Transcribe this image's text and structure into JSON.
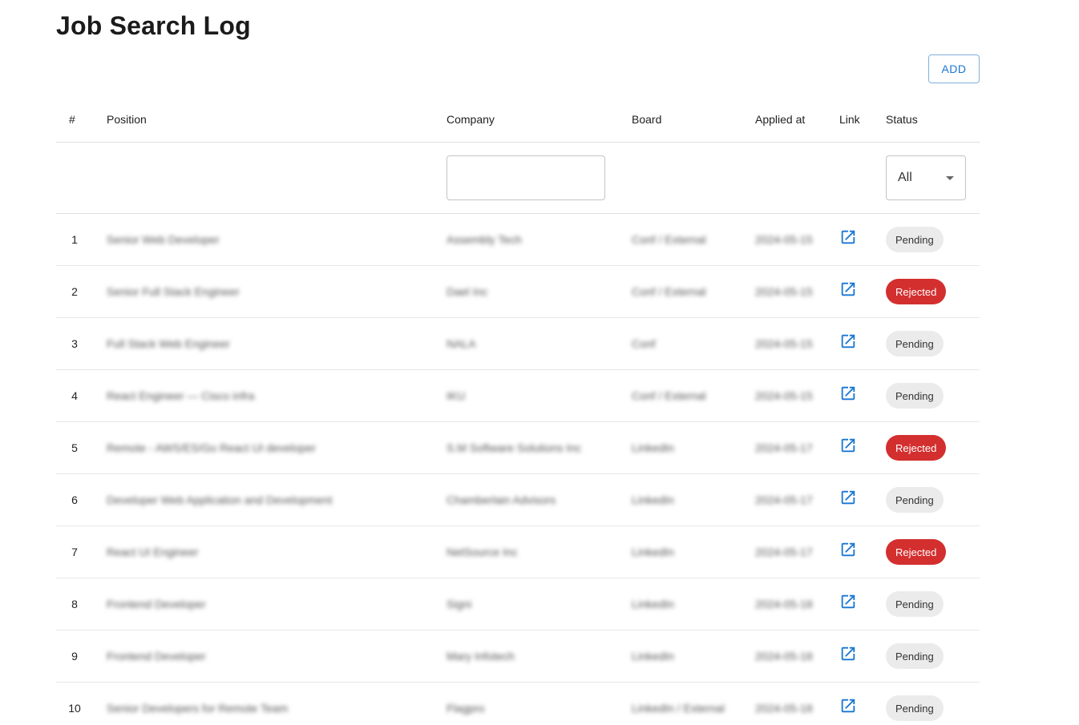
{
  "page": {
    "title": "Job Search Log",
    "add_label": "ADD"
  },
  "table": {
    "headers": {
      "num": "#",
      "position": "Position",
      "company": "Company",
      "board": "Board",
      "applied_at": "Applied at",
      "link": "Link",
      "status": "Status"
    },
    "filters": {
      "company_value": "",
      "status_selected": "All"
    },
    "rows": [
      {
        "num": "1",
        "position": "Senior Web Developer",
        "company": "Assembly Tech",
        "board": "Conf / External",
        "applied_at": "2024-05-15",
        "status": "Pending"
      },
      {
        "num": "2",
        "position": "Senior Full Stack Engineer",
        "company": "Dael Inc",
        "board": "Conf / External",
        "applied_at": "2024-05-15",
        "status": "Rejected"
      },
      {
        "num": "3",
        "position": "Full Stack Web Engineer",
        "company": "NALA",
        "board": "Conf",
        "applied_at": "2024-05-15",
        "status": "Pending"
      },
      {
        "num": "4",
        "position": "React Engineer — Cisco infra",
        "company": "IKU",
        "board": "Conf / External",
        "applied_at": "2024-05-15",
        "status": "Pending"
      },
      {
        "num": "5",
        "position": "Remote - AWS/ES/Go React UI developer",
        "company": "S.M Software Solutions Inc",
        "board": "LinkedIn",
        "applied_at": "2024-05-17",
        "status": "Rejected"
      },
      {
        "num": "6",
        "position": "Developer Web Application and Development",
        "company": "Chamberlain Advisors",
        "board": "LinkedIn",
        "applied_at": "2024-05-17",
        "status": "Pending"
      },
      {
        "num": "7",
        "position": "React UI Engineer",
        "company": "NetSource Inc",
        "board": "LinkedIn",
        "applied_at": "2024-05-17",
        "status": "Rejected"
      },
      {
        "num": "8",
        "position": "Frontend Developer",
        "company": "Signi",
        "board": "LinkedIn",
        "applied_at": "2024-05-18",
        "status": "Pending"
      },
      {
        "num": "9",
        "position": "Frontend Developer",
        "company": "Mary Infotech",
        "board": "LinkedIn",
        "applied_at": "2024-05-18",
        "status": "Pending"
      },
      {
        "num": "10",
        "position": "Senior Developers for Remote Team",
        "company": "Flagpro",
        "board": "LinkedIn / External",
        "applied_at": "2024-05-18",
        "status": "Pending"
      }
    ]
  },
  "colors": {
    "accent": "#1976d2",
    "rejected": "#d32f2f",
    "pending_bg": "#ebebeb"
  },
  "icons": {
    "link": "open-in-new-icon",
    "select": "caret-down-icon"
  }
}
